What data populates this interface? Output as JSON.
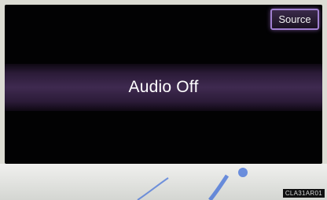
{
  "screen": {
    "source_button_label": "Source",
    "status_text": "Audio Off"
  },
  "footer": {
    "image_code": "CLA31AR01"
  },
  "colors": {
    "screen_background": "#020203",
    "accent_purple": "#a07fd0",
    "status_band": "#3f2a50",
    "bottom_band": "#e8e8e4"
  },
  "icons": {
    "decoration": "swoosh-icon"
  }
}
